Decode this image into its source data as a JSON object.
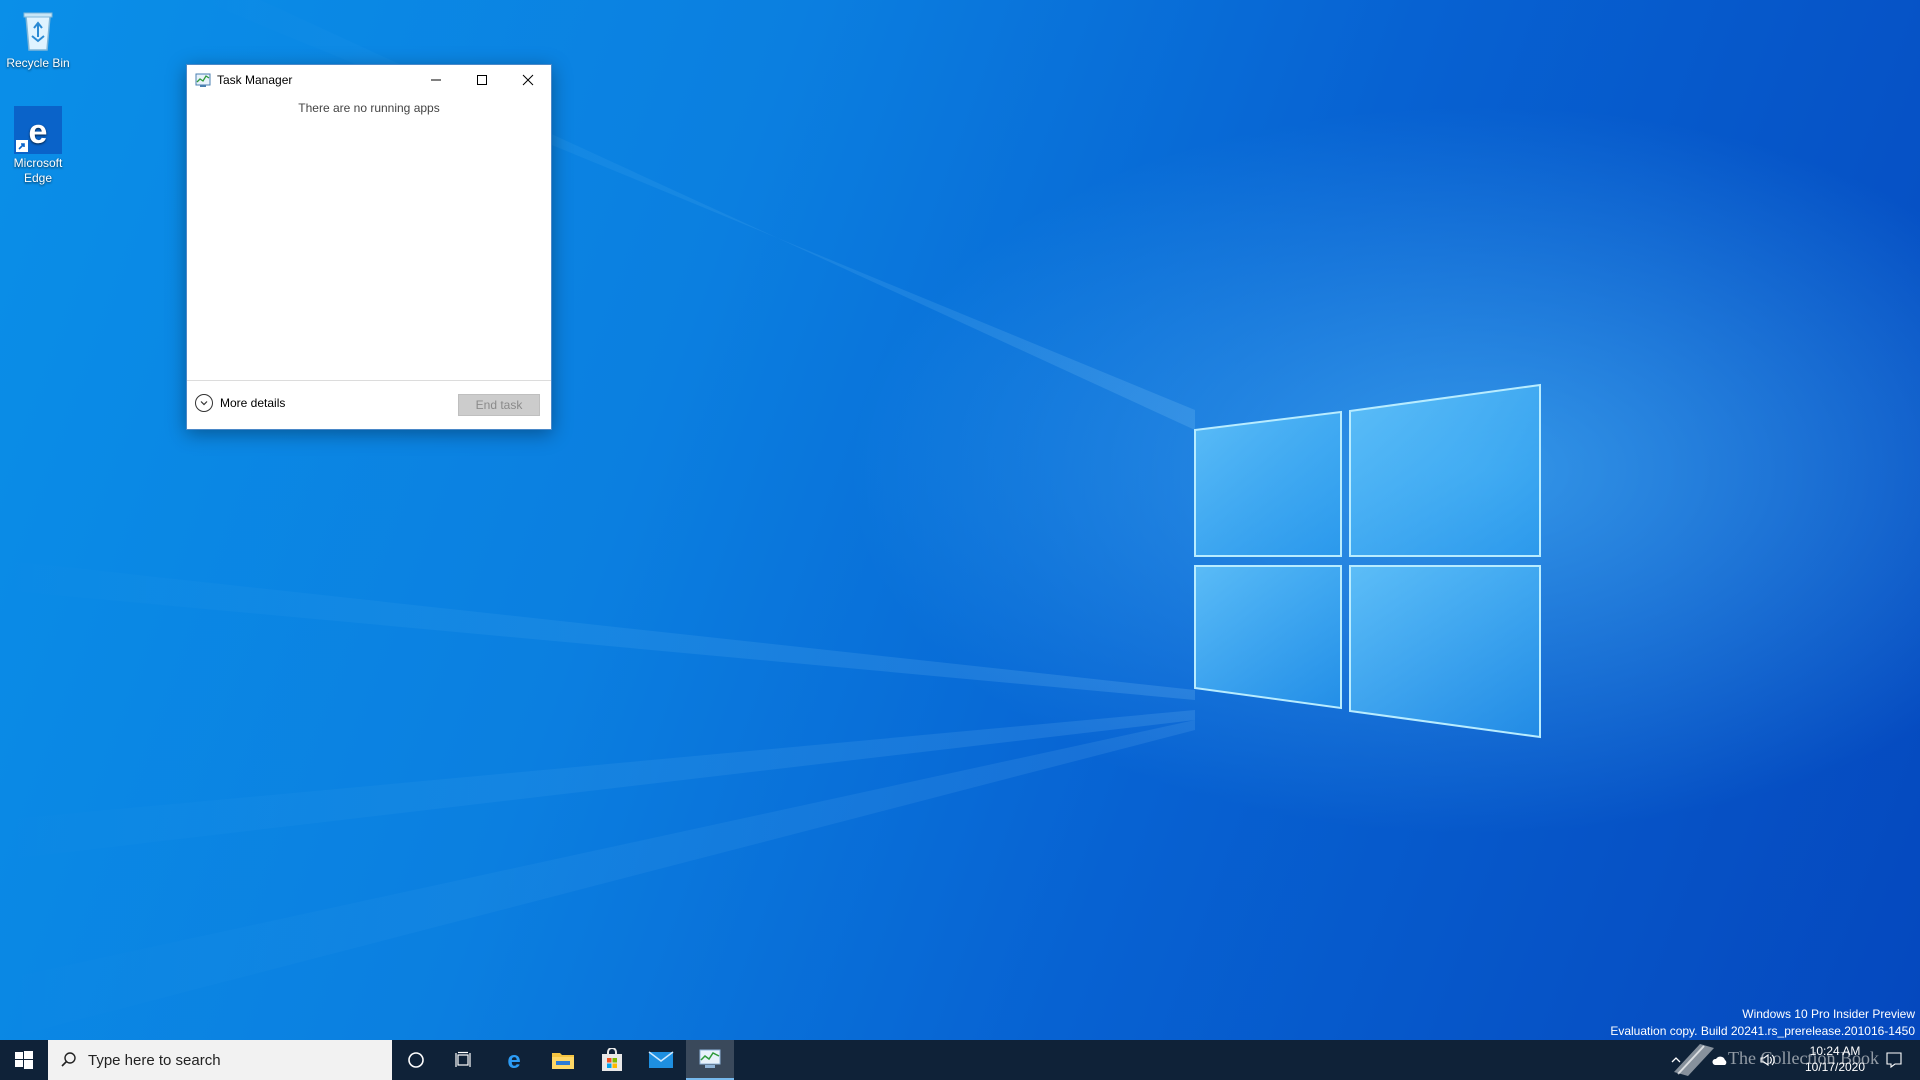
{
  "desktop": {
    "icons": [
      {
        "label": "Recycle Bin",
        "icon": "recycle-bin-icon"
      },
      {
        "label": "Microsoft Edge",
        "icon": "edge-icon"
      }
    ]
  },
  "task_manager": {
    "title": "Task Manager",
    "empty_message": "There are no running apps",
    "more_details_label": "More details",
    "end_task_label": "End task"
  },
  "watermark": {
    "line1": "Windows 10 Pro Insider Preview",
    "line2": "Evaluation copy. Build 20241.rs_prerelease.201016-1450"
  },
  "taskbar": {
    "search_placeholder": "Type here to search",
    "pinned": [
      "cortana-icon",
      "task-view-icon",
      "edge-icon",
      "file-explorer-icon",
      "store-icon",
      "mail-icon",
      "task-manager-icon"
    ],
    "active_app": "task-manager-icon",
    "clock_time": "10:24 AM",
    "clock_date": "10/17/2020",
    "overlay_text": "The Collection Book"
  },
  "colors": {
    "taskbar_bg": "#0f2238",
    "desktop_accent": "#0b7fe0",
    "window_border": "#4a88c8"
  }
}
